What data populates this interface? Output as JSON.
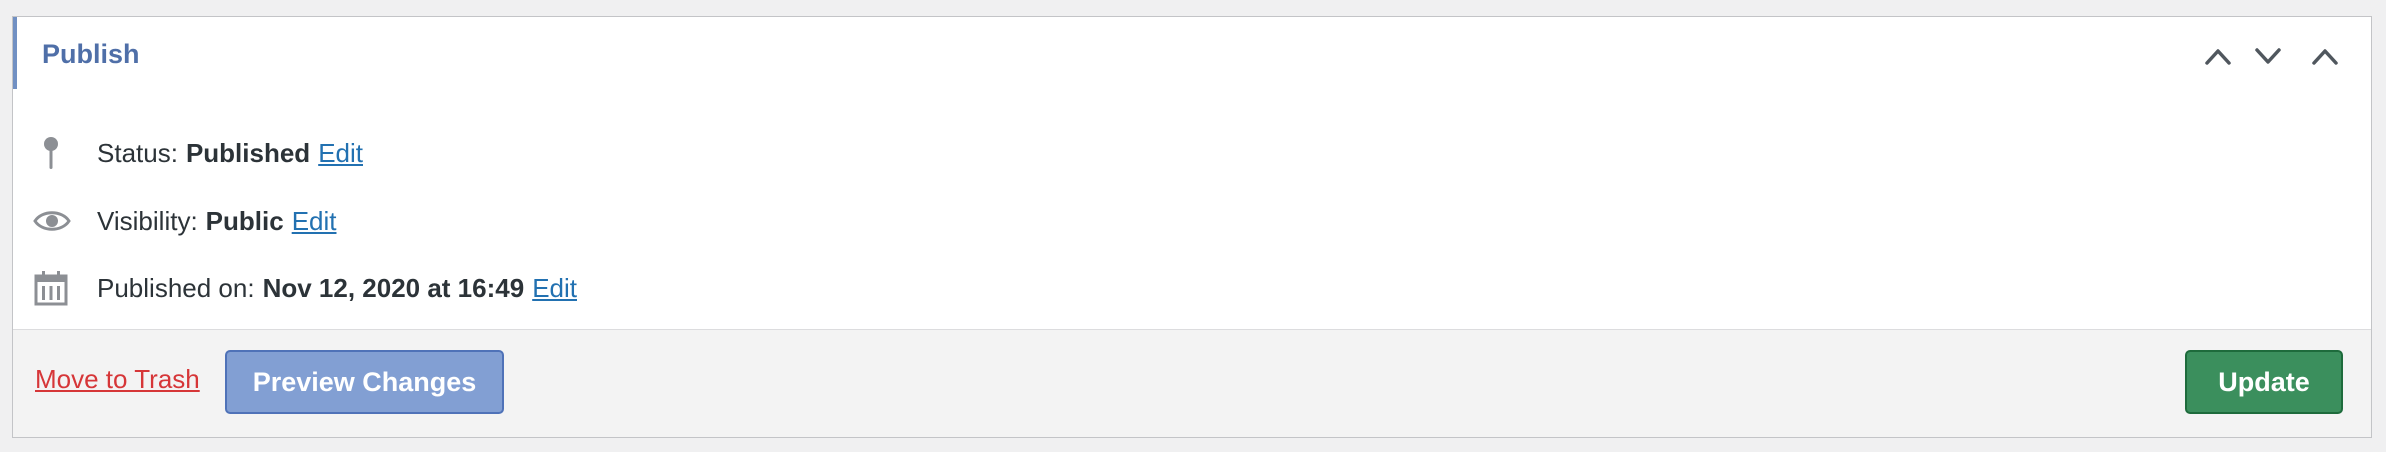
{
  "panel": {
    "title": "Publish",
    "controls": {
      "move_up_icon": "chevron-up-icon",
      "move_down_icon": "chevron-down-icon",
      "toggle_icon": "chevron-up-icon"
    }
  },
  "status": {
    "icon": "pin-icon",
    "label": "Status:",
    "value": "Published",
    "edit_label": "Edit"
  },
  "visibility": {
    "icon": "eye-icon",
    "label": "Visibility:",
    "value": "Public",
    "edit_label": "Edit"
  },
  "published_on": {
    "icon": "calendar-icon",
    "label": "Published on:",
    "value": "Nov 12, 2020 at 16:49",
    "edit_label": "Edit"
  },
  "footer": {
    "trash_label": "Move to Trash",
    "preview_label": "Preview Changes",
    "update_label": "Update"
  },
  "colors": {
    "accent": "#7190c3",
    "link": "#2271b1",
    "danger": "#d63638",
    "preview_button": "#829fd3",
    "update_button": "#3b8f5d"
  }
}
